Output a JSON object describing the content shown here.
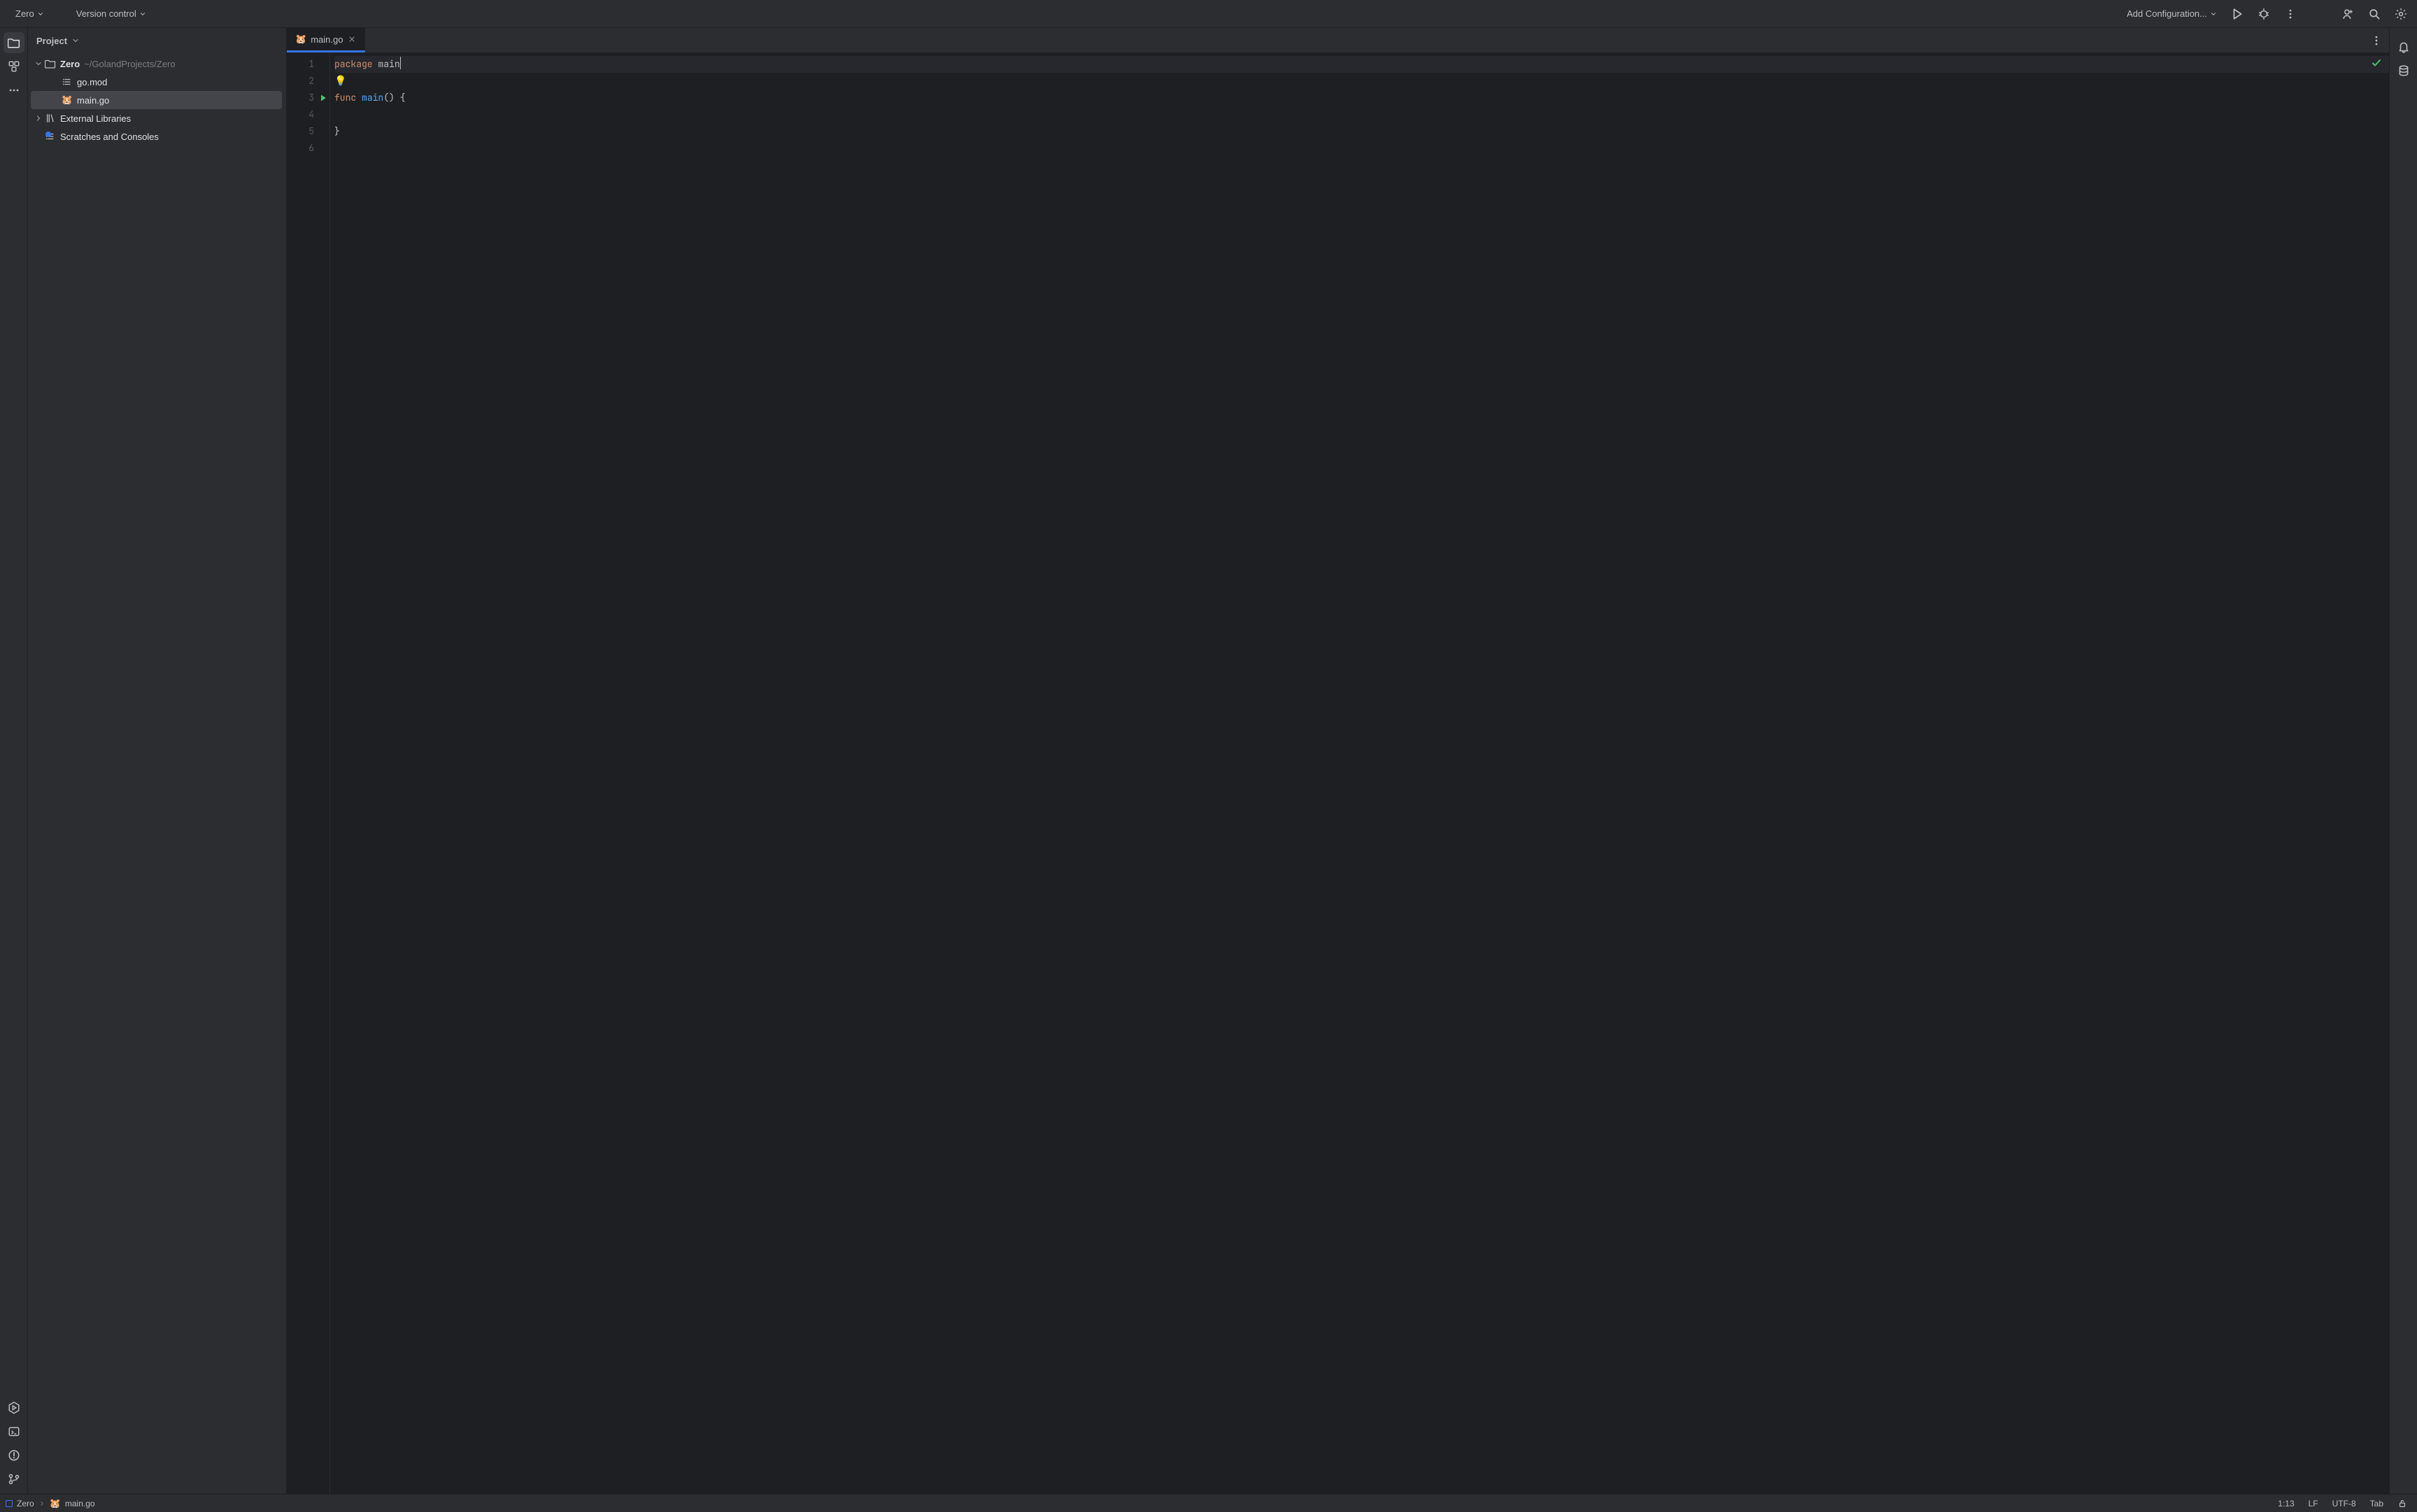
{
  "titlebar": {
    "project_menu_label": "Zero",
    "version_control_label": "Version control",
    "run_config_label": "Add Configuration..."
  },
  "left_toolstrip": {
    "items": [
      {
        "name": "project-tool",
        "active": true
      },
      {
        "name": "structure-tool",
        "active": false
      },
      {
        "name": "more-tool",
        "active": false
      }
    ],
    "bottom_items": [
      {
        "name": "services-tool"
      },
      {
        "name": "terminal-tool"
      },
      {
        "name": "problems-tool"
      },
      {
        "name": "git-tool"
      }
    ]
  },
  "right_toolstrip": {
    "items": [
      {
        "name": "notifications-tool"
      },
      {
        "name": "database-tool"
      }
    ]
  },
  "project_window": {
    "title": "Project",
    "tree": {
      "root": {
        "name": "Zero",
        "path": "~/GolandProjects/Zero",
        "expanded": true,
        "children": [
          {
            "name": "go.mod",
            "icon": "gomod",
            "selected": false
          },
          {
            "name": "main.go",
            "icon": "go",
            "selected": true
          }
        ]
      },
      "extras": [
        {
          "name": "External Libraries",
          "icon": "library",
          "expandable": true
        },
        {
          "name": "Scratches and Consoles",
          "icon": "scratch",
          "expandable": false
        }
      ]
    }
  },
  "tabs": [
    {
      "name": "main.go",
      "icon": "go",
      "active": true
    }
  ],
  "editor": {
    "lines": [
      {
        "n": "1",
        "segments": [
          {
            "t": "package",
            "c": "kw"
          },
          {
            "t": " "
          },
          {
            "t": "main",
            "c": "ident"
          }
        ],
        "current": true,
        "caret_after": true
      },
      {
        "n": "2",
        "segments": [],
        "bulb": true
      },
      {
        "n": "3",
        "segments": [
          {
            "t": "func",
            "c": "kw"
          },
          {
            "t": " "
          },
          {
            "t": "main",
            "c": "fn"
          },
          {
            "t": "() {",
            "c": "ident"
          }
        ],
        "runnable": true
      },
      {
        "n": "4",
        "segments": []
      },
      {
        "n": "5",
        "segments": [
          {
            "t": "}",
            "c": "ident"
          }
        ]
      },
      {
        "n": "6",
        "segments": []
      }
    ],
    "status_ok": true
  },
  "statusbar": {
    "crumbs": [
      {
        "label": "Zero",
        "icon": "project-sq"
      },
      {
        "label": "main.go",
        "icon": "go"
      }
    ],
    "caret_pos": "1:13",
    "line_sep": "LF",
    "encoding": "UTF-8",
    "indent": "Tab",
    "readonly": false
  }
}
